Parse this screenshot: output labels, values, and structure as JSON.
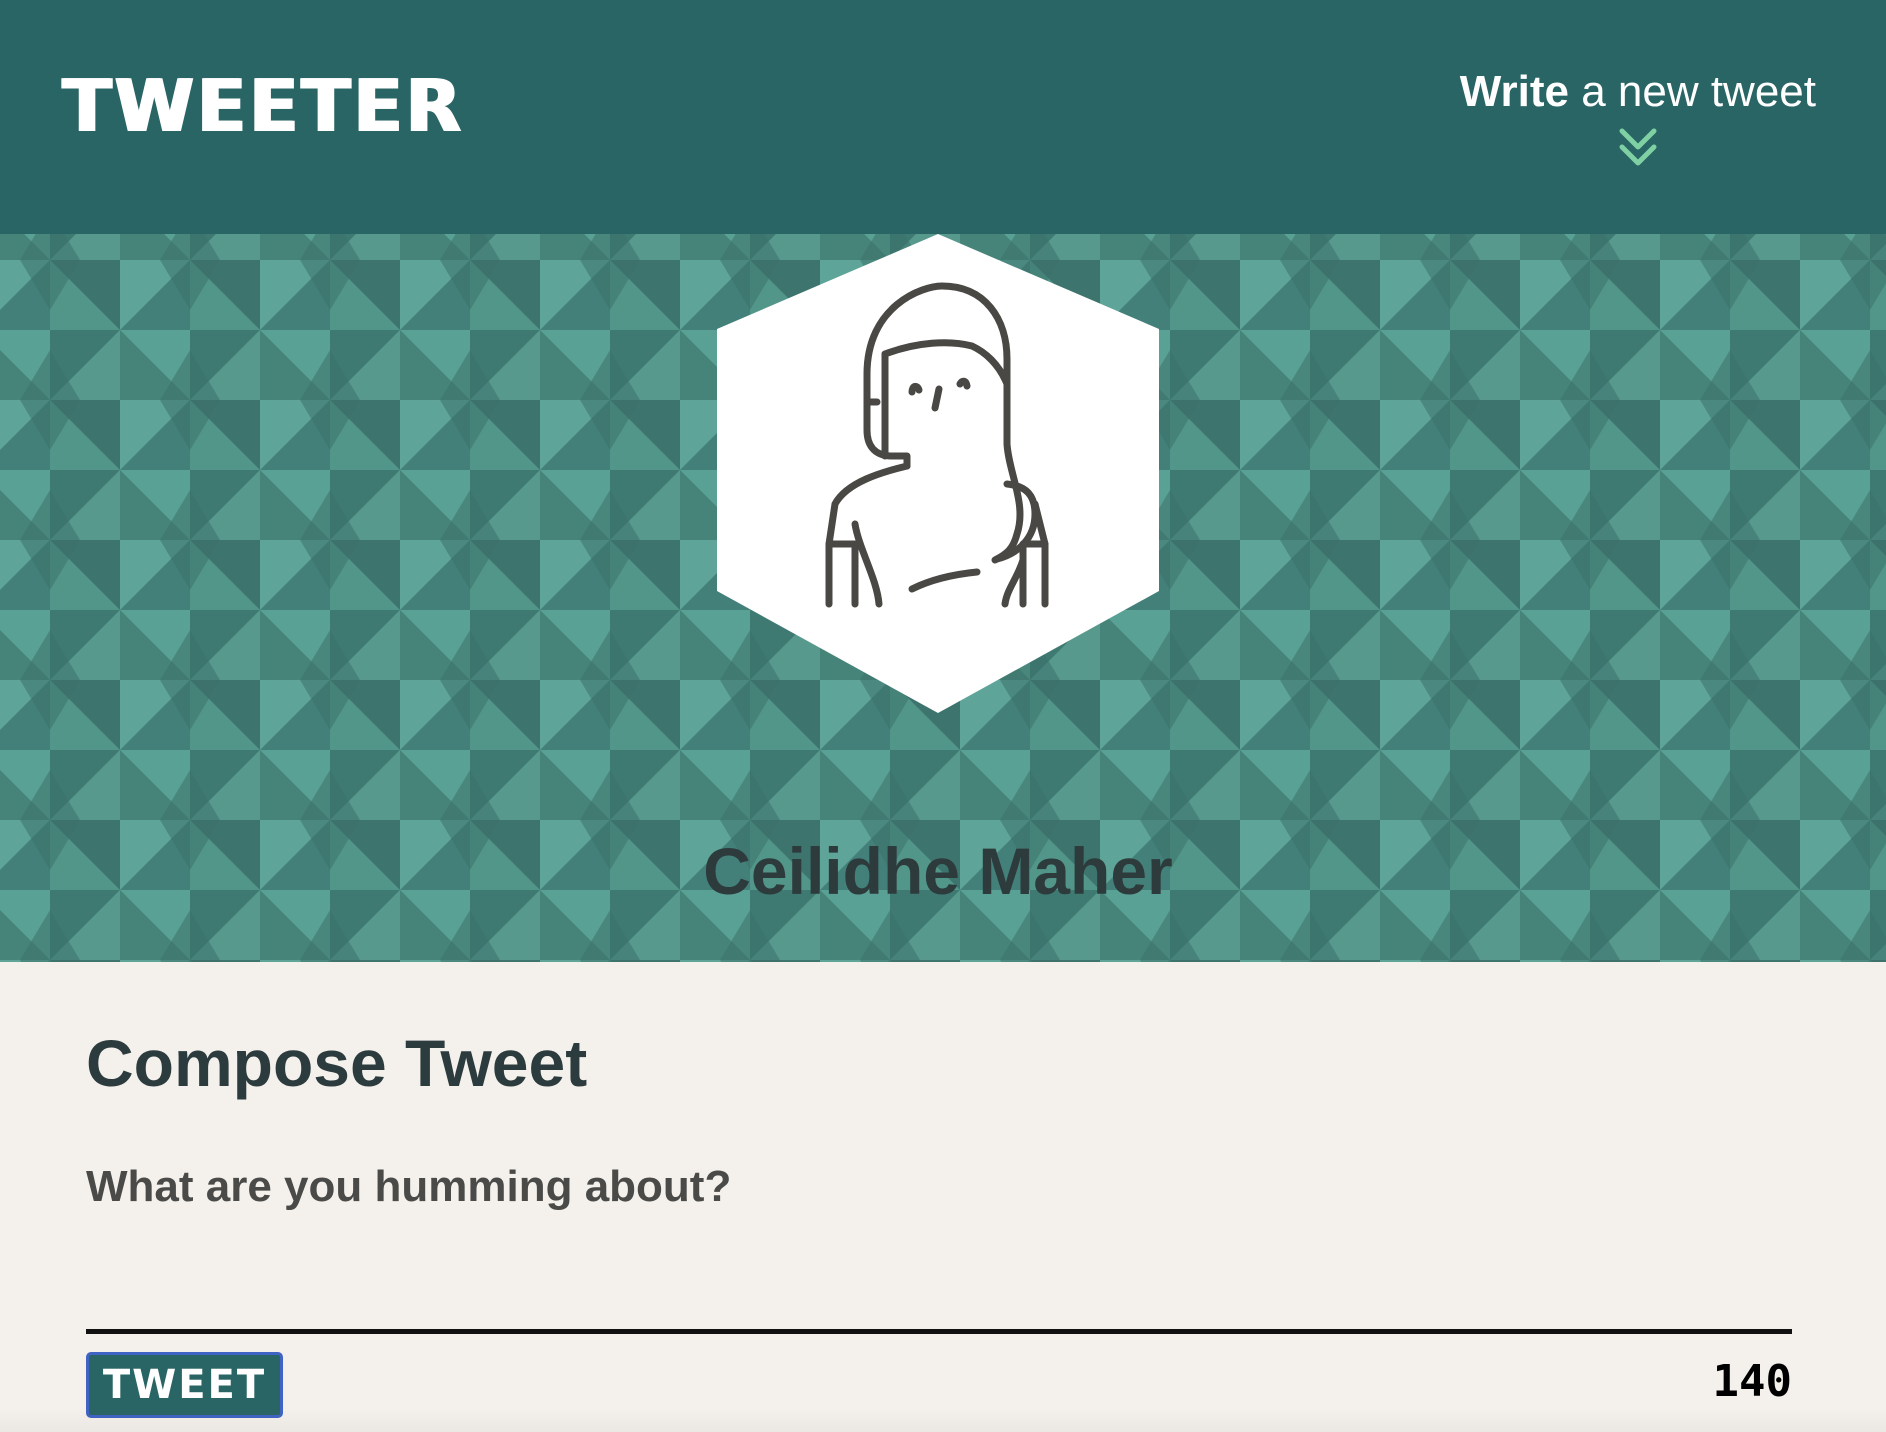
{
  "nav": {
    "logo": "TWEETER",
    "compose_toggle": {
      "bold": "Write",
      "rest": " a new tweet",
      "icon": "double-chevron-down-icon"
    }
  },
  "profile": {
    "name": "Ceilidhe Maher",
    "avatar_icon": "woman-avatar-icon"
  },
  "compose": {
    "title": "Compose Tweet",
    "placeholder": "What are you humming about?",
    "value": "",
    "button_label": "TWEET",
    "counter": "140"
  },
  "colors": {
    "nav_bg": "#2a6565",
    "header_bg": "#4e9186",
    "page_bg": "#f4f1ec",
    "accent_chevron": "#7fd1a3",
    "text_dark": "#2c3b3d"
  }
}
